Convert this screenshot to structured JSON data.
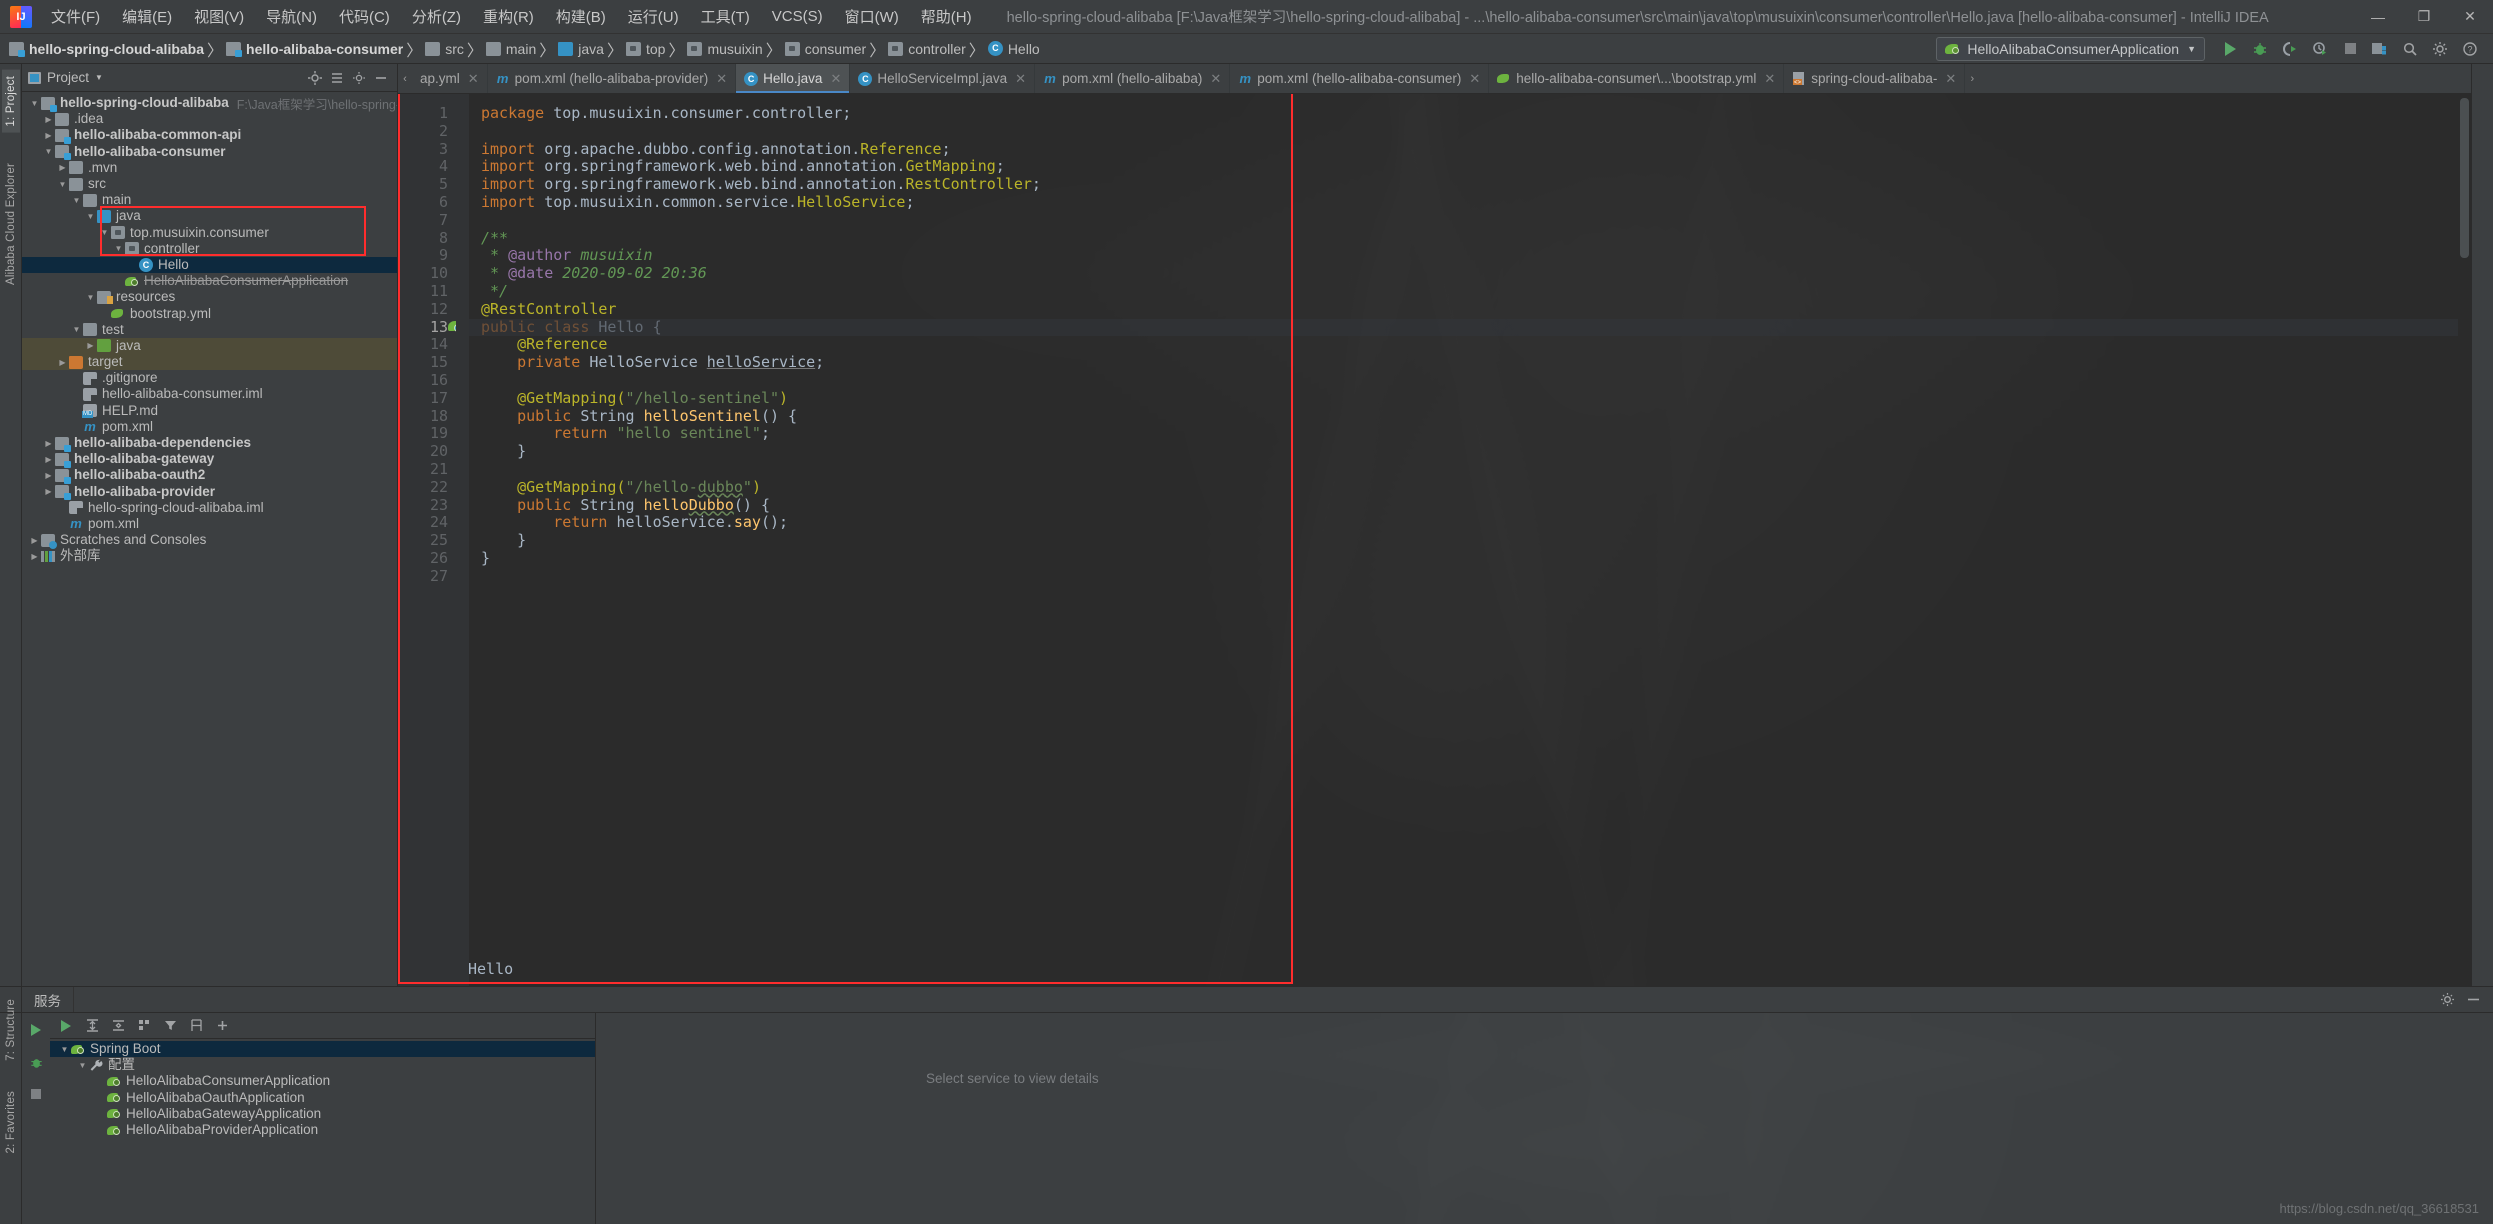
{
  "titlebar": {
    "logo": "intellij-idea-logo",
    "menu": [
      "文件(F)",
      "编辑(E)",
      "视图(V)",
      "导航(N)",
      "代码(C)",
      "分析(Z)",
      "重构(R)",
      "构建(B)",
      "运行(U)",
      "工具(T)",
      "VCS(S)",
      "窗口(W)",
      "帮助(H)"
    ],
    "window_title": "hello-spring-cloud-alibaba [F:\\Java框架学习\\hello-spring-cloud-alibaba] - ...\\hello-alibaba-consumer\\src\\main\\java\\top\\musuixin\\consumer\\controller\\Hello.java [hello-alibaba-consumer] - IntelliJ IDEA",
    "minimize": "—",
    "maximize": "❐",
    "close": "✕"
  },
  "navbar": {
    "crumbs": [
      {
        "label": "hello-spring-cloud-alibaba",
        "icon": "module-icon",
        "bold": true
      },
      {
        "label": "hello-alibaba-consumer",
        "icon": "module-icon",
        "bold": true
      },
      {
        "label": "src",
        "icon": "folder-icon",
        "bold": false
      },
      {
        "label": "main",
        "icon": "folder-icon",
        "bold": false
      },
      {
        "label": "java",
        "icon": "source-folder-icon",
        "bold": false
      },
      {
        "label": "top",
        "icon": "package-icon",
        "bold": false
      },
      {
        "label": "musuixin",
        "icon": "package-icon",
        "bold": false
      },
      {
        "label": "consumer",
        "icon": "package-icon",
        "bold": false
      },
      {
        "label": "controller",
        "icon": "package-icon",
        "bold": false
      },
      {
        "label": "Hello",
        "icon": "class-icon",
        "bold": false
      }
    ],
    "run_config": "HelloAlibabaConsumerApplication",
    "run_config_icon": "spring-boot-icon",
    "buttons": [
      "run-icon",
      "debug-icon",
      "run-coverage-icon",
      "profiler-icon",
      "stop-icon",
      "project-structure-icon",
      "search-icon",
      "settings-icon",
      "help-icon"
    ]
  },
  "left_strips": {
    "top": [
      "1: Project"
    ],
    "left_vertical": [
      "Alibaba Cloud Explorer"
    ],
    "bottom": [
      "7: Structure",
      "2: Favorites"
    ]
  },
  "project_panel": {
    "title": "Project",
    "title_icon": "project-view-icon",
    "actions": [
      "locate-icon",
      "expand-icon",
      "settings-icon",
      "hide-icon"
    ],
    "tree": [
      {
        "depth": 0,
        "arrow": "▼",
        "icon": "module-icon",
        "label": "hello-spring-cloud-alibaba",
        "bold": true,
        "hint": "F:\\Java框架学习\\hello-spring-cloud-alibaba"
      },
      {
        "depth": 1,
        "arrow": "▶",
        "icon": "folder-icon",
        "label": ".idea",
        "bold": false
      },
      {
        "depth": 1,
        "arrow": "▶",
        "icon": "module-icon",
        "label": "hello-alibaba-common-api",
        "bold": true
      },
      {
        "depth": 1,
        "arrow": "▼",
        "icon": "module-icon",
        "label": "hello-alibaba-consumer",
        "bold": true
      },
      {
        "depth": 2,
        "arrow": "▶",
        "icon": "folder-icon",
        "label": ".mvn",
        "bold": false
      },
      {
        "depth": 2,
        "arrow": "▼",
        "icon": "folder-icon",
        "label": "src",
        "bold": false
      },
      {
        "depth": 3,
        "arrow": "▼",
        "icon": "folder-icon",
        "label": "main",
        "bold": false
      },
      {
        "depth": 4,
        "arrow": "▼",
        "icon": "source-folder-icon",
        "label": "java",
        "bold": false
      },
      {
        "depth": 5,
        "arrow": "▼",
        "icon": "package-icon",
        "label": "top.musuixin.consumer",
        "bold": false
      },
      {
        "depth": 6,
        "arrow": "▼",
        "icon": "package-icon",
        "label": "controller",
        "bold": false
      },
      {
        "depth": 7,
        "arrow": "",
        "icon": "class-icon",
        "label": "Hello",
        "bold": false,
        "selected": true
      },
      {
        "depth": 6,
        "arrow": "",
        "icon": "spring-run-icon",
        "label": "HelloAlibabaConsumerApplication",
        "bold": false,
        "strike": true
      },
      {
        "depth": 4,
        "arrow": "▼",
        "icon": "resources-folder-icon",
        "label": "resources",
        "bold": false
      },
      {
        "depth": 5,
        "arrow": "",
        "icon": "yaml-icon",
        "label": "bootstrap.yml",
        "bold": false
      },
      {
        "depth": 3,
        "arrow": "▼",
        "icon": "folder-icon",
        "label": "test",
        "bold": false
      },
      {
        "depth": 4,
        "arrow": "▶",
        "icon": "test-source-folder-icon",
        "label": "java",
        "bold": false,
        "testhl": true
      },
      {
        "depth": 2,
        "arrow": "▶",
        "icon": "target-folder-icon",
        "label": "target",
        "bold": false,
        "targethl": true
      },
      {
        "depth": 3,
        "arrow": "",
        "icon": "gitignore-icon",
        "label": ".gitignore",
        "bold": false
      },
      {
        "depth": 3,
        "arrow": "",
        "icon": "iml-icon",
        "label": "hello-alibaba-consumer.iml",
        "bold": false
      },
      {
        "depth": 3,
        "arrow": "",
        "icon": "markdown-icon",
        "label": "HELP.md",
        "bold": false
      },
      {
        "depth": 3,
        "arrow": "",
        "icon": "maven-icon",
        "label": "pom.xml",
        "bold": false
      },
      {
        "depth": 1,
        "arrow": "▶",
        "icon": "module-icon",
        "label": "hello-alibaba-dependencies",
        "bold": true
      },
      {
        "depth": 1,
        "arrow": "▶",
        "icon": "module-icon",
        "label": "hello-alibaba-gateway",
        "bold": true
      },
      {
        "depth": 1,
        "arrow": "▶",
        "icon": "module-icon",
        "label": "hello-alibaba-oauth2",
        "bold": true
      },
      {
        "depth": 1,
        "arrow": "▶",
        "icon": "module-icon",
        "label": "hello-alibaba-provider",
        "bold": true
      },
      {
        "depth": 2,
        "arrow": "",
        "icon": "iml-icon",
        "label": "hello-spring-cloud-alibaba.iml",
        "bold": false
      },
      {
        "depth": 2,
        "arrow": "",
        "icon": "maven-icon",
        "label": "pom.xml",
        "bold": false
      },
      {
        "depth": 0,
        "arrow": "▶",
        "icon": "scratches-icon",
        "label": "Scratches and Consoles",
        "bold": false
      },
      {
        "depth": 0,
        "arrow": "▶",
        "icon": "external-libraries-icon",
        "label": "外部库",
        "bold": false
      }
    ]
  },
  "editor": {
    "tabs": [
      {
        "label": "ap.yml",
        "icon": "yaml-icon",
        "active": false,
        "closable": true
      },
      {
        "label": "pom.xml (hello-alibaba-provider)",
        "icon": "maven-icon",
        "active": false,
        "closable": true
      },
      {
        "label": "Hello.java",
        "icon": "class-icon",
        "active": true,
        "closable": true
      },
      {
        "label": "HelloServiceImpl.java",
        "icon": "class-icon",
        "active": false,
        "closable": true
      },
      {
        "label": "pom.xml (hello-alibaba)",
        "icon": "maven-icon",
        "active": false,
        "closable": true
      },
      {
        "label": "pom.xml (hello-alibaba-consumer)",
        "icon": "maven-icon",
        "active": false,
        "closable": true
      },
      {
        "label": "hello-alibaba-consumer\\...\\bootstrap.yml",
        "icon": "yaml-icon",
        "active": false,
        "closable": true
      },
      {
        "label": "spring-cloud-alibaba-",
        "icon": "xml-icon",
        "active": false,
        "closable": true
      }
    ],
    "line_count": 27,
    "current_line": 13,
    "gutter_bean_line": 13,
    "bottom_hint": "Hello",
    "code_lines": [
      [
        {
          "t": "package ",
          "c": "kw"
        },
        {
          "t": "top.musuixin.consumer.controller;",
          "c": "imp"
        }
      ],
      [],
      [
        {
          "t": "import ",
          "c": "kw"
        },
        {
          "t": "org.apache.dubbo.config.annotation.",
          "c": "imp"
        },
        {
          "t": "Reference",
          "c": "imp-cls"
        },
        {
          "t": ";",
          "c": "imp"
        }
      ],
      [
        {
          "t": "import ",
          "c": "kw"
        },
        {
          "t": "org.springframework.web.bind.annotation.",
          "c": "imp"
        },
        {
          "t": "GetMapping",
          "c": "imp-cls"
        },
        {
          "t": ";",
          "c": "imp"
        }
      ],
      [
        {
          "t": "import ",
          "c": "kw"
        },
        {
          "t": "org.springframework.web.bind.annotation.",
          "c": "imp"
        },
        {
          "t": "RestController",
          "c": "imp-cls"
        },
        {
          "t": ";",
          "c": "imp"
        }
      ],
      [
        {
          "t": "import ",
          "c": "kw"
        },
        {
          "t": "top.musuixin.common.service.",
          "c": "imp"
        },
        {
          "t": "HelloService",
          "c": "imp-cls"
        },
        {
          "t": ";",
          "c": "imp"
        }
      ],
      [],
      [
        {
          "t": "/**",
          "c": "cmt"
        }
      ],
      [
        {
          "t": " * ",
          "c": "cmt"
        },
        {
          "t": "@author",
          "c": "field"
        },
        {
          "t": " musuixin",
          "c": "cmt"
        }
      ],
      [
        {
          "t": " * ",
          "c": "cmt"
        },
        {
          "t": "@date",
          "c": "field"
        },
        {
          "t": " 2020-09-02 20:36",
          "c": "cmt"
        }
      ],
      [
        {
          "t": " */",
          "c": "cmt"
        }
      ],
      [
        {
          "t": "@RestController",
          "c": "ann"
        }
      ],
      [
        {
          "t": "public ",
          "c": "kw"
        },
        {
          "t": "class ",
          "c": "kw"
        },
        {
          "t": "Hello ",
          "c": "cls-n"
        },
        {
          "t": "{",
          "c": "cls-n"
        }
      ],
      [
        {
          "t": "    @Reference",
          "c": "ann"
        }
      ],
      [
        {
          "t": "    private ",
          "c": "kw"
        },
        {
          "t": "HelloService ",
          "c": "cls-n"
        },
        {
          "t": "helloService",
          "c": "field-u"
        },
        {
          "t": ";",
          "c": "cls-n"
        }
      ],
      [],
      [
        {
          "t": "    @GetMapping(",
          "c": "ann"
        },
        {
          "t": "\"/hello-sentinel\"",
          "c": "str"
        },
        {
          "t": ")",
          "c": "ann"
        }
      ],
      [
        {
          "t": "    public ",
          "c": "kw"
        },
        {
          "t": "String ",
          "c": "cls-n"
        },
        {
          "t": "helloSentinel",
          "c": "meth"
        },
        {
          "t": "() {",
          "c": "cls-n"
        }
      ],
      [
        {
          "t": "        return ",
          "c": "kw"
        },
        {
          "t": "\"hello sentinel\"",
          "c": "str"
        },
        {
          "t": ";",
          "c": "cls-n"
        }
      ],
      [
        {
          "t": "    }",
          "c": "cls-n"
        }
      ],
      [],
      [
        {
          "t": "    @GetMapping(",
          "c": "ann"
        },
        {
          "t": "\"/hello-",
          "c": "str"
        },
        {
          "t": "dubbo",
          "c": "str-w"
        },
        {
          "t": "\"",
          "c": "str"
        },
        {
          "t": ")",
          "c": "ann"
        }
      ],
      [
        {
          "t": "    public ",
          "c": "kw"
        },
        {
          "t": "String ",
          "c": "cls-n"
        },
        {
          "t": "hello",
          "c": "meth"
        },
        {
          "t": "Dubbo",
          "c": "meth-w"
        },
        {
          "t": "() {",
          "c": "cls-n"
        }
      ],
      [
        {
          "t": "        return ",
          "c": "kw"
        },
        {
          "t": "helloService",
          "c": "cls-n"
        },
        {
          "t": ".",
          "c": "cls-n"
        },
        {
          "t": "say",
          "c": "meth"
        },
        {
          "t": "();",
          "c": "cls-n"
        }
      ],
      [
        {
          "t": "    }",
          "c": "cls-n"
        }
      ],
      [
        {
          "t": "}",
          "c": "cls-n"
        }
      ],
      []
    ]
  },
  "services": {
    "tab_label": "服务",
    "toolbar_buttons": [
      "run-icon",
      "expand-all-icon",
      "collapse-all-icon",
      "group-icon",
      "filter-icon",
      "show-config-icon",
      "add-icon"
    ],
    "side_buttons": [
      "run-icon",
      "debug-icon",
      "stop-icon"
    ],
    "tree": [
      {
        "depth": 0,
        "arrow": "▼",
        "icon": "spring-boot-icon",
        "label": "Spring Boot",
        "selected": true
      },
      {
        "depth": 1,
        "arrow": "▼",
        "icon": "wrench-icon",
        "label": "配置"
      },
      {
        "depth": 2,
        "arrow": "",
        "icon": "spring-run-icon",
        "label": "HelloAlibabaConsumerApplication"
      },
      {
        "depth": 2,
        "arrow": "",
        "icon": "spring-run-icon",
        "label": "HelloAlibabaOauthApplication"
      },
      {
        "depth": 2,
        "arrow": "",
        "icon": "spring-run-icon",
        "label": "HelloAlibabaGatewayApplication"
      },
      {
        "depth": 2,
        "arrow": "",
        "icon": "spring-run-icon",
        "label": "HelloAlibabaProviderApplication"
      }
    ],
    "detail_placeholder": "Select service to view details",
    "watermark": "https://blog.csdn.net/qq_36618531"
  },
  "colors": {
    "accent": "#3592c4",
    "spring_green": "#6db33f",
    "selection": "#0d293e",
    "highlight_red": "#ff2d2d",
    "editor_bg": "#2b2b2b",
    "panel_bg": "#3c3f41"
  }
}
